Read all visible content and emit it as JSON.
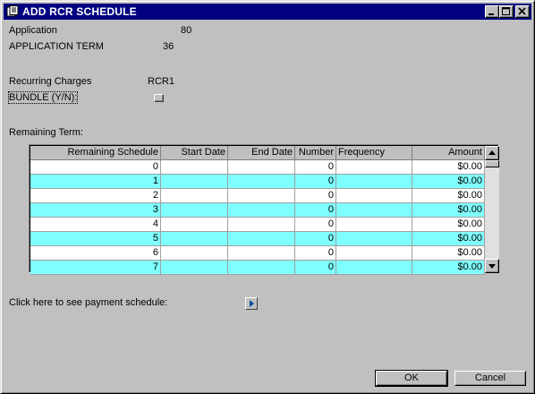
{
  "window": {
    "title": "ADD RCR SCHEDULE",
    "icon": "app-document-icon",
    "controls": [
      "minimize-icon",
      "maximize-icon",
      "close-icon"
    ]
  },
  "form": {
    "application_label": "Application",
    "application_value": "80",
    "term_label": "APPLICATION TERM",
    "term_value": "36",
    "recurring_label": "Recurring Charges",
    "recurring_value": "RCR1",
    "bundle_label": "BUNDLE (Y/N):",
    "remaining_label": "Remaining Term:"
  },
  "grid": {
    "columns": [
      "Remaining Schedule",
      "Start Date",
      "End Date",
      "Number",
      "Frequency",
      "Amount"
    ],
    "rows": [
      {
        "schedule": "0",
        "start": "",
        "end": "",
        "number": "0",
        "frequency": "",
        "amount": "$0.00"
      },
      {
        "schedule": "1",
        "start": "",
        "end": "",
        "number": "0",
        "frequency": "",
        "amount": "$0.00"
      },
      {
        "schedule": "2",
        "start": "",
        "end": "",
        "number": "0",
        "frequency": "",
        "amount": "$0.00"
      },
      {
        "schedule": "3",
        "start": "",
        "end": "",
        "number": "0",
        "frequency": "",
        "amount": "$0.00"
      },
      {
        "schedule": "4",
        "start": "",
        "end": "",
        "number": "0",
        "frequency": "",
        "amount": "$0.00"
      },
      {
        "schedule": "5",
        "start": "",
        "end": "",
        "number": "0",
        "frequency": "",
        "amount": "$0.00"
      },
      {
        "schedule": "6",
        "start": "",
        "end": "",
        "number": "0",
        "frequency": "",
        "amount": "$0.00"
      },
      {
        "schedule": "7",
        "start": "",
        "end": "",
        "number": "0",
        "frequency": "",
        "amount": "$0.00"
      }
    ],
    "alt_row_color": "#80ffff",
    "row_color": "#ffffff"
  },
  "payment": {
    "label": "Click here to see payment schedule:",
    "icon": "play-arrow-icon"
  },
  "buttons": {
    "ok": "OK",
    "cancel": "Cancel"
  },
  "colors": {
    "titlebar": "#000080",
    "face": "#c0c0c0"
  }
}
